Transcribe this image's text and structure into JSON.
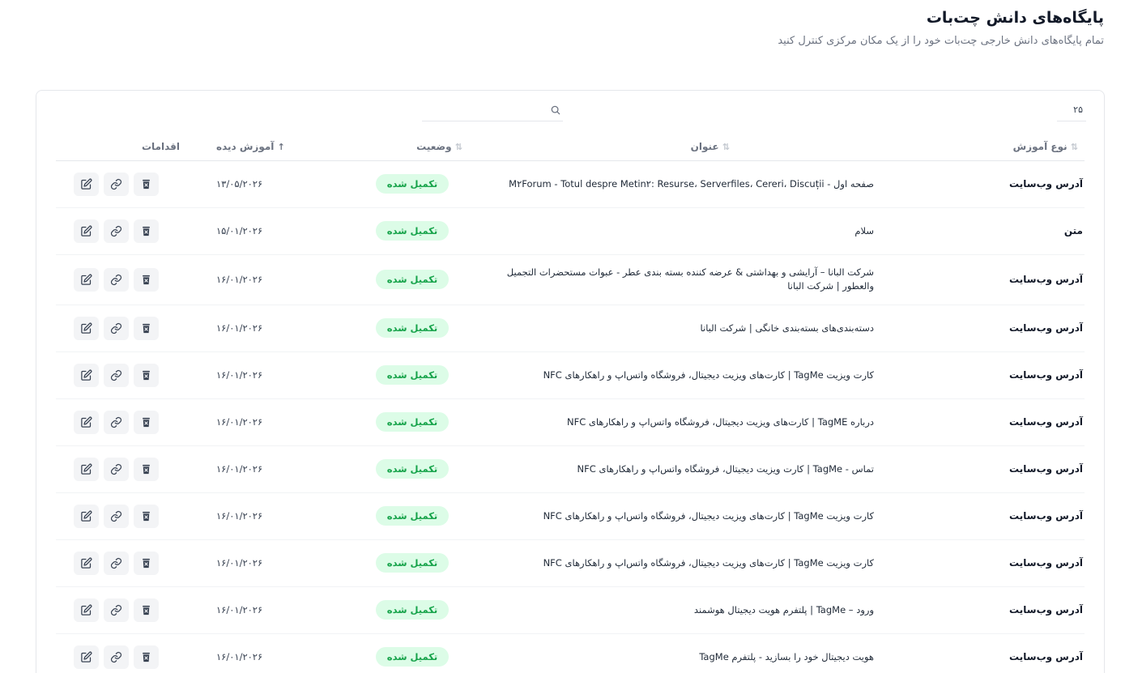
{
  "header": {
    "title": "پایگاه‌های دانش چت‌بات",
    "subtitle": "تمام پایگاه‌های دانش خارجی چت‌بات خود را از یک مکان مرکزی کنترل کنید"
  },
  "toolbar": {
    "page_size": "۲۵",
    "search_placeholder": "",
    "search_icon": "search-icon"
  },
  "table": {
    "columns": {
      "type": "نوع آموزش",
      "title": "عنوان",
      "status": "وضعیت",
      "trained": "آموزش دیده",
      "actions": "اقدامات"
    },
    "action_icons": [
      "edit-icon",
      "link-icon",
      "delete-icon"
    ],
    "rows": [
      {
        "type": "آدرس وب‌سایت",
        "title": "صفحه اول - M۲Forum - Totul despre Metin۲: Resurse، Serverfiles، Cereri، Discuții",
        "status": "تکمیل شده",
        "date": "۱۳/۰۵/۲۰۲۶"
      },
      {
        "type": "متن",
        "title": "سلام",
        "status": "تکمیل شده",
        "date": "۱۵/۰۱/۲۰۲۶"
      },
      {
        "type": "آدرس وب‌سایت",
        "title": "شرکت البانا – آرایشی و بهداشتی & عرضه کننده بسته بندی عطر - عبوات مستحضرات التجميل والعطور | شرکت البانا",
        "status": "تکمیل شده",
        "date": "۱۶/۰۱/۲۰۲۶"
      },
      {
        "type": "آدرس وب‌سایت",
        "title": "دسته‌بندی‌های بسته‌بندی خانگی | شرکت البانا",
        "status": "تکمیل شده",
        "date": "۱۶/۰۱/۲۰۲۶"
      },
      {
        "type": "آدرس وب‌سایت",
        "title": "کارت ویزیت TagMe | کارت‌های ویزیت دیجیتال، فروشگاه واتس‌اپ و راهکارهای NFC",
        "status": "تکمیل شده",
        "date": "۱۶/۰۱/۲۰۲۶"
      },
      {
        "type": "آدرس وب‌سایت",
        "title": "درباره TagME | کارت‌های ویزیت دیجیتال، فروشگاه واتس‌اپ و راهکارهای NFC",
        "status": "تکمیل شده",
        "date": "۱۶/۰۱/۲۰۲۶"
      },
      {
        "type": "آدرس وب‌سایت",
        "title": "تماس - TagMe | کارت ویزیت دیجیتال، فروشگاه واتس‌اپ و راهکارهای NFC",
        "status": "تکمیل شده",
        "date": "۱۶/۰۱/۲۰۲۶"
      },
      {
        "type": "آدرس وب‌سایت",
        "title": "کارت ویزیت TagMe | کارت‌های ویزیت دیجیتال، فروشگاه واتس‌اپ و راهکارهای NFC",
        "status": "تکمیل شده",
        "date": "۱۶/۰۱/۲۰۲۶"
      },
      {
        "type": "آدرس وب‌سایت",
        "title": "کارت ویزیت TagMe | کارت‌های ویزیت دیجیتال، فروشگاه واتس‌اپ و راهکارهای NFC",
        "status": "تکمیل شده",
        "date": "۱۶/۰۱/۲۰۲۶"
      },
      {
        "type": "آدرس وب‌سایت",
        "title": "ورود – TagMe | پلتفرم هویت دیجیتال هوشمند",
        "status": "تکمیل شده",
        "date": "۱۶/۰۱/۲۰۲۶"
      },
      {
        "type": "آدرس وب‌سایت",
        "title": "هویت دیجیتال خود را بسازید - پلتفرم TagMe",
        "status": "تکمیل شده",
        "date": "۱۶/۰۱/۲۰۲۶"
      }
    ]
  },
  "colors": {
    "status_bg": "#dcfce7",
    "status_text": "#16a34a",
    "action_bg": "#f3f4f6",
    "action_icon": "#374151"
  }
}
